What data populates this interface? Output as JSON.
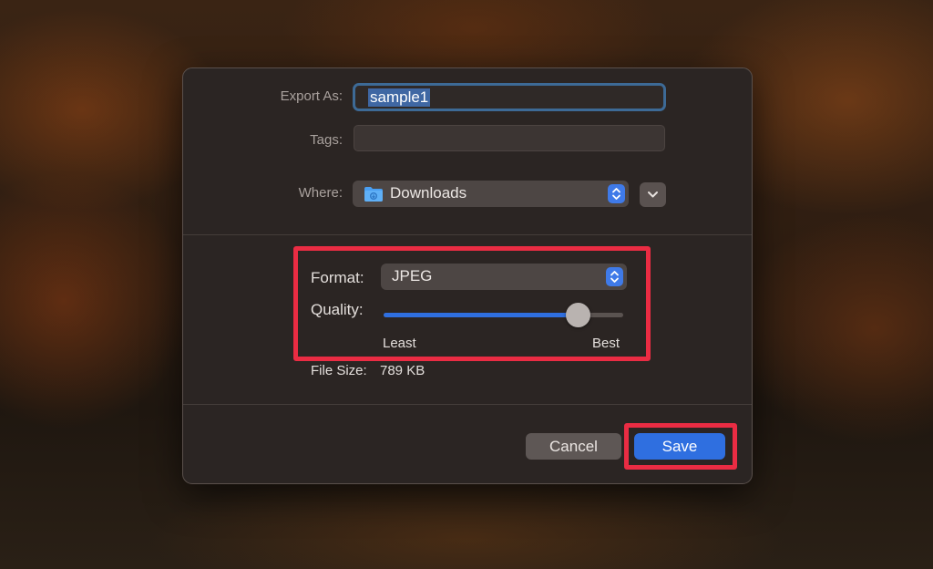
{
  "dialog": {
    "export_as_label": "Export As:",
    "export_as_value": "sample1",
    "tags_label": "Tags:",
    "tags_value": "",
    "where_label": "Where:",
    "where_value": "Downloads",
    "format_label": "Format:",
    "format_value": "JPEG",
    "quality_label": "Quality:",
    "quality_level": 0.81,
    "quality_min_label": "Least",
    "quality_max_label": "Best",
    "file_size_label": "File Size:",
    "file_size_value": "789 KB",
    "cancel_label": "Cancel",
    "save_label": "Save"
  },
  "colors": {
    "accent": "#2f6fe0",
    "highlight": "#ea2c43",
    "focus_ring": "#3d6a96"
  },
  "icons": {
    "folder": "folder-icon",
    "stepper": "stepper-icon",
    "disclosure": "chevron-down-icon"
  }
}
